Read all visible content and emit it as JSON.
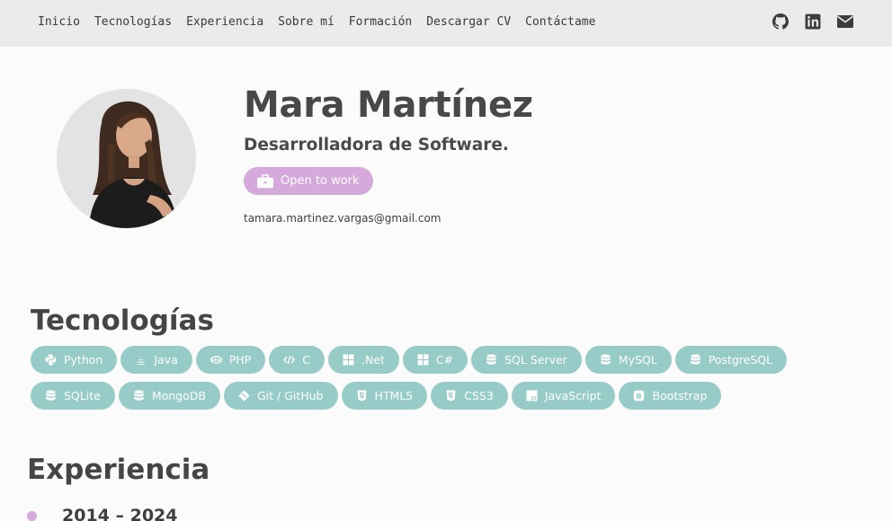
{
  "nav": {
    "links": [
      "Inicio",
      "Tecnologías",
      "Experiencia",
      "Sobre mí",
      "Formación",
      "Descargar CV",
      "Contáctame"
    ],
    "icons": [
      "github-icon",
      "linkedin-icon",
      "envelope-icon"
    ]
  },
  "hero": {
    "name": "Mara Martínez",
    "role": "Desarrolladora de Software.",
    "badge": "Open to work",
    "email": "tamara.martinez.vargas@gmail.com"
  },
  "tech": {
    "title": "Tecnologías",
    "items": [
      {
        "label": "Python",
        "icon": "python-icon"
      },
      {
        "label": "Java",
        "icon": "java-icon"
      },
      {
        "label": "PHP",
        "icon": "php-icon"
      },
      {
        "label": "C",
        "icon": "code-icon"
      },
      {
        "label": ".Net",
        "icon": "windows-icon"
      },
      {
        "label": "C#",
        "icon": "windows-icon"
      },
      {
        "label": "SQL Server",
        "icon": "database-icon"
      },
      {
        "label": "MySQL",
        "icon": "database-icon"
      },
      {
        "label": "PostgreSQL",
        "icon": "database-icon"
      },
      {
        "label": "SQLite",
        "icon": "database-icon"
      },
      {
        "label": "MongoDB",
        "icon": "database-icon"
      },
      {
        "label": "Git / GitHub",
        "icon": "git-icon"
      },
      {
        "label": "HTML5",
        "icon": "html5-icon"
      },
      {
        "label": "CSS3",
        "icon": "css3-icon"
      },
      {
        "label": "JavaScript",
        "icon": "js-icon"
      },
      {
        "label": "Bootstrap",
        "icon": "bootstrap-icon"
      }
    ]
  },
  "experience": {
    "title": "Experiencia",
    "first_date": "2014 – 2024"
  },
  "colors": {
    "nav_bg": "#ebebeb",
    "chip": "#97cbc8",
    "accent": "#d5a9dc",
    "text": "#454545"
  }
}
